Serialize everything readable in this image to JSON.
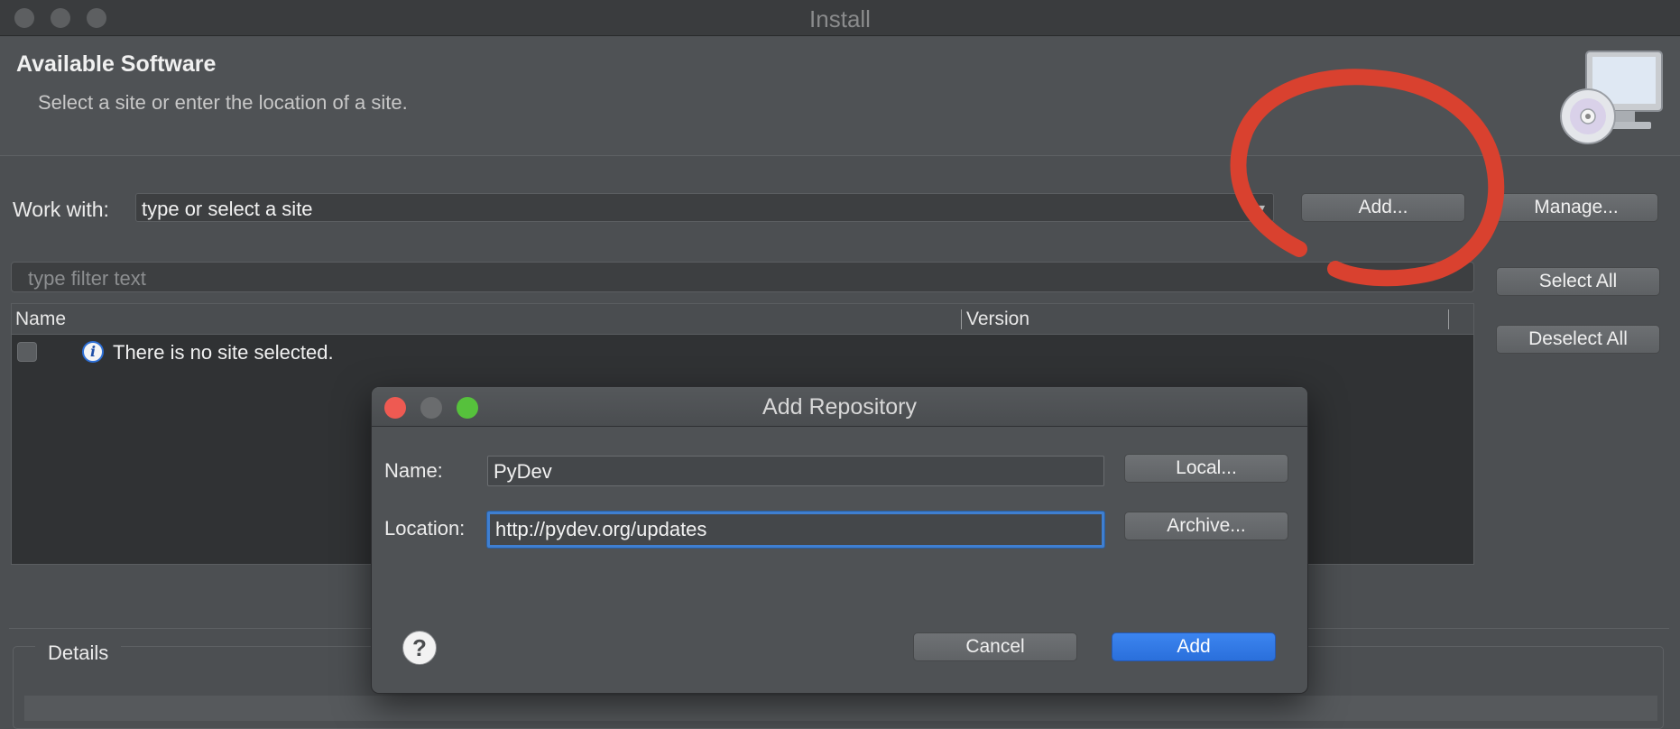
{
  "window": {
    "title": "Install"
  },
  "header": {
    "title": "Available Software",
    "subtitle": "Select a site or enter the location of a site."
  },
  "work_with": {
    "label": "Work with:",
    "value": "type or select a site",
    "add_label": "Add...",
    "manage_label": "Manage..."
  },
  "filter": {
    "placeholder": "type filter text"
  },
  "actions": {
    "select_all_label": "Select All",
    "deselect_all_label": "Deselect All"
  },
  "table": {
    "columns": [
      "Name",
      "Version"
    ],
    "rows": [
      {
        "text": "There is no site selected.",
        "icon": "info-icon"
      }
    ]
  },
  "details": {
    "label": "Details"
  },
  "annotation": {
    "color": "#d9412f",
    "shape": "freehand-circle"
  },
  "dialog": {
    "title": "Add Repository",
    "name_label": "Name:",
    "name_value": "PyDev",
    "location_label": "Location:",
    "location_value": "http://pydev.org/updates",
    "local_label": "Local...",
    "archive_label": "Archive...",
    "cancel_label": "Cancel",
    "add_label": "Add"
  },
  "colors": {
    "accent": "#2f74e0",
    "close": "#ee5a52",
    "maximize": "#56c13c"
  }
}
